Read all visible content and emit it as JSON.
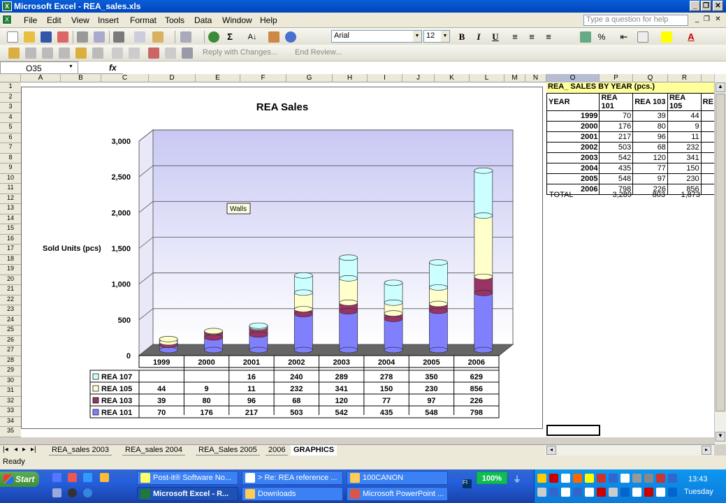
{
  "window": {
    "title": "Microsoft Excel - REA_sales.xls"
  },
  "menu": {
    "items": [
      "File",
      "Edit",
      "View",
      "Insert",
      "Format",
      "Tools",
      "Data",
      "Window",
      "Help"
    ],
    "help_placeholder": "Type a question for help"
  },
  "toolbar": {
    "font": "Arial",
    "size": "12",
    "reply_label": "Reply with Changes...",
    "end_review_label": "End Review..."
  },
  "formula": {
    "namebox": "O35",
    "fx": "fx"
  },
  "columns": [
    "A",
    "B",
    "C",
    "D",
    "E",
    "F",
    "G",
    "H",
    "I",
    "J",
    "K",
    "L",
    "M",
    "N",
    "O",
    "P",
    "Q",
    "R"
  ],
  "rows": [
    "1",
    "2",
    "3",
    "4",
    "5",
    "6",
    "7",
    "8",
    "9",
    "10",
    "11",
    "12",
    "13",
    "14",
    "15",
    "16",
    "17",
    "18",
    "19",
    "20",
    "21",
    "22",
    "23",
    "24",
    "25",
    "26",
    "27",
    "28",
    "29",
    "30",
    "31",
    "32",
    "33",
    "34",
    "35"
  ],
  "sheet": {
    "header": "REA_ SALES BY YEAR (pcs.)",
    "col_headers": [
      "YEAR",
      "REA 101",
      "REA 103",
      "REA 105",
      "RE"
    ],
    "rows": [
      [
        "1999",
        "70",
        "39",
        "44"
      ],
      [
        "2000",
        "176",
        "80",
        "9"
      ],
      [
        "2001",
        "217",
        "96",
        "11"
      ],
      [
        "2002",
        "503",
        "68",
        "232"
      ],
      [
        "2003",
        "542",
        "120",
        "341"
      ],
      [
        "2004",
        "435",
        "77",
        "150"
      ],
      [
        "2005",
        "548",
        "97",
        "230"
      ],
      [
        "2006",
        "798",
        "226",
        "856"
      ]
    ],
    "total_label": "TOTAL",
    "totals": [
      "3,289",
      "803",
      "1,873"
    ]
  },
  "chart_data": {
    "type": "bar",
    "stacked": true,
    "title": "REA Sales",
    "ylabel": "Sold Units (pcs)",
    "xlabel": "",
    "ylim": [
      0,
      3000
    ],
    "yticks": [
      "0",
      "500",
      "1,000",
      "1,500",
      "2,000",
      "2,500",
      "3,000"
    ],
    "categories": [
      "1999",
      "2000",
      "2001",
      "2002",
      "2003",
      "2004",
      "2005",
      "2006"
    ],
    "series": [
      {
        "name": "REA 101",
        "color": "#8080ff",
        "values": [
          70,
          176,
          217,
          503,
          542,
          435,
          548,
          798
        ]
      },
      {
        "name": "REA 103",
        "color": "#993366",
        "values": [
          39,
          80,
          96,
          68,
          120,
          77,
          97,
          226
        ]
      },
      {
        "name": "REA 105",
        "color": "#ffffcc",
        "values": [
          44,
          9,
          11,
          232,
          341,
          150,
          230,
          856
        ]
      },
      {
        "name": "REA 107",
        "color": "#ccffff",
        "values": [
          null,
          null,
          16,
          240,
          289,
          278,
          350,
          629
        ]
      }
    ],
    "table_rows": [
      {
        "name": "REA 107",
        "cells": [
          "",
          "",
          "16",
          "240",
          "289",
          "278",
          "350",
          "629"
        ]
      },
      {
        "name": "REA 105",
        "cells": [
          "44",
          "9",
          "11",
          "232",
          "341",
          "150",
          "230",
          "856"
        ]
      },
      {
        "name": "REA 103",
        "cells": [
          "39",
          "80",
          "96",
          "68",
          "120",
          "77",
          "97",
          "226"
        ]
      },
      {
        "name": "REA 101",
        "cells": [
          "70",
          "176",
          "217",
          "503",
          "542",
          "435",
          "548",
          "798"
        ]
      }
    ],
    "tooltip": "Walls",
    "grid": true,
    "legend": "data table"
  },
  "sheet_tabs": [
    "REA_sales 2003",
    "REA_sales 2004",
    "REA_Sales 2005",
    "2006",
    "GRAPHICS"
  ],
  "status": {
    "text": "Ready"
  },
  "taskbar": {
    "start": "Start",
    "tasks": [
      "Post-it® Software No...",
      "> Re: REA reference ...",
      "100CANON",
      "Microsoft Excel - R...",
      "Downloads",
      "Microsoft PowerPoint ..."
    ],
    "zoom": "100%",
    "time": "13:43",
    "day": "Tuesday"
  }
}
